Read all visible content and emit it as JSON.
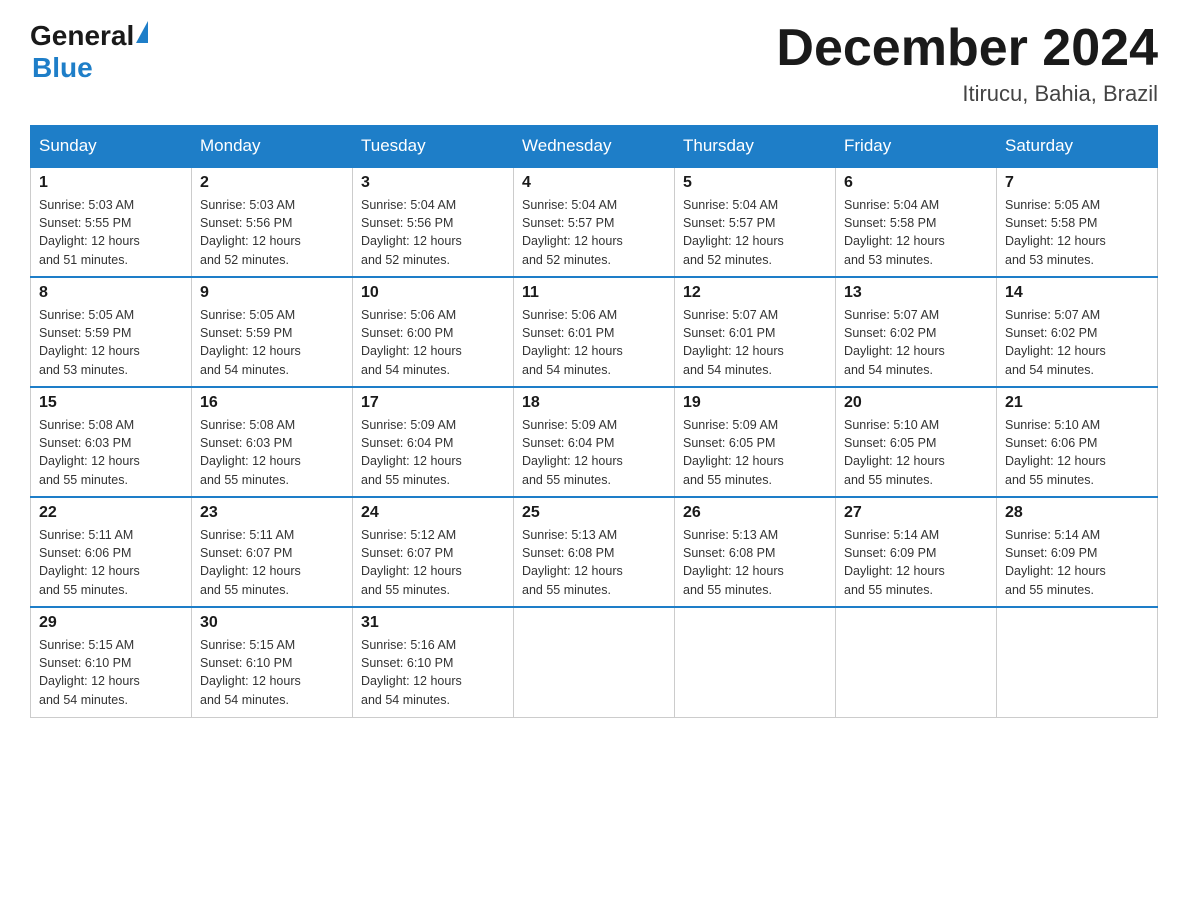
{
  "header": {
    "logo_general": "General",
    "logo_blue": "Blue",
    "title": "December 2024",
    "subtitle": "Itirucu, Bahia, Brazil"
  },
  "weekdays": [
    "Sunday",
    "Monday",
    "Tuesday",
    "Wednesday",
    "Thursday",
    "Friday",
    "Saturday"
  ],
  "weeks": [
    [
      {
        "day": "1",
        "sunrise": "5:03 AM",
        "sunset": "5:55 PM",
        "daylight": "12 hours and 51 minutes."
      },
      {
        "day": "2",
        "sunrise": "5:03 AM",
        "sunset": "5:56 PM",
        "daylight": "12 hours and 52 minutes."
      },
      {
        "day": "3",
        "sunrise": "5:04 AM",
        "sunset": "5:56 PM",
        "daylight": "12 hours and 52 minutes."
      },
      {
        "day": "4",
        "sunrise": "5:04 AM",
        "sunset": "5:57 PM",
        "daylight": "12 hours and 52 minutes."
      },
      {
        "day": "5",
        "sunrise": "5:04 AM",
        "sunset": "5:57 PM",
        "daylight": "12 hours and 52 minutes."
      },
      {
        "day": "6",
        "sunrise": "5:04 AM",
        "sunset": "5:58 PM",
        "daylight": "12 hours and 53 minutes."
      },
      {
        "day": "7",
        "sunrise": "5:05 AM",
        "sunset": "5:58 PM",
        "daylight": "12 hours and 53 minutes."
      }
    ],
    [
      {
        "day": "8",
        "sunrise": "5:05 AM",
        "sunset": "5:59 PM",
        "daylight": "12 hours and 53 minutes."
      },
      {
        "day": "9",
        "sunrise": "5:05 AM",
        "sunset": "5:59 PM",
        "daylight": "12 hours and 54 minutes."
      },
      {
        "day": "10",
        "sunrise": "5:06 AM",
        "sunset": "6:00 PM",
        "daylight": "12 hours and 54 minutes."
      },
      {
        "day": "11",
        "sunrise": "5:06 AM",
        "sunset": "6:01 PM",
        "daylight": "12 hours and 54 minutes."
      },
      {
        "day": "12",
        "sunrise": "5:07 AM",
        "sunset": "6:01 PM",
        "daylight": "12 hours and 54 minutes."
      },
      {
        "day": "13",
        "sunrise": "5:07 AM",
        "sunset": "6:02 PM",
        "daylight": "12 hours and 54 minutes."
      },
      {
        "day": "14",
        "sunrise": "5:07 AM",
        "sunset": "6:02 PM",
        "daylight": "12 hours and 54 minutes."
      }
    ],
    [
      {
        "day": "15",
        "sunrise": "5:08 AM",
        "sunset": "6:03 PM",
        "daylight": "12 hours and 55 minutes."
      },
      {
        "day": "16",
        "sunrise": "5:08 AM",
        "sunset": "6:03 PM",
        "daylight": "12 hours and 55 minutes."
      },
      {
        "day": "17",
        "sunrise": "5:09 AM",
        "sunset": "6:04 PM",
        "daylight": "12 hours and 55 minutes."
      },
      {
        "day": "18",
        "sunrise": "5:09 AM",
        "sunset": "6:04 PM",
        "daylight": "12 hours and 55 minutes."
      },
      {
        "day": "19",
        "sunrise": "5:09 AM",
        "sunset": "6:05 PM",
        "daylight": "12 hours and 55 minutes."
      },
      {
        "day": "20",
        "sunrise": "5:10 AM",
        "sunset": "6:05 PM",
        "daylight": "12 hours and 55 minutes."
      },
      {
        "day": "21",
        "sunrise": "5:10 AM",
        "sunset": "6:06 PM",
        "daylight": "12 hours and 55 minutes."
      }
    ],
    [
      {
        "day": "22",
        "sunrise": "5:11 AM",
        "sunset": "6:06 PM",
        "daylight": "12 hours and 55 minutes."
      },
      {
        "day": "23",
        "sunrise": "5:11 AM",
        "sunset": "6:07 PM",
        "daylight": "12 hours and 55 minutes."
      },
      {
        "day": "24",
        "sunrise": "5:12 AM",
        "sunset": "6:07 PM",
        "daylight": "12 hours and 55 minutes."
      },
      {
        "day": "25",
        "sunrise": "5:13 AM",
        "sunset": "6:08 PM",
        "daylight": "12 hours and 55 minutes."
      },
      {
        "day": "26",
        "sunrise": "5:13 AM",
        "sunset": "6:08 PM",
        "daylight": "12 hours and 55 minutes."
      },
      {
        "day": "27",
        "sunrise": "5:14 AM",
        "sunset": "6:09 PM",
        "daylight": "12 hours and 55 minutes."
      },
      {
        "day": "28",
        "sunrise": "5:14 AM",
        "sunset": "6:09 PM",
        "daylight": "12 hours and 55 minutes."
      }
    ],
    [
      {
        "day": "29",
        "sunrise": "5:15 AM",
        "sunset": "6:10 PM",
        "daylight": "12 hours and 54 minutes."
      },
      {
        "day": "30",
        "sunrise": "5:15 AM",
        "sunset": "6:10 PM",
        "daylight": "12 hours and 54 minutes."
      },
      {
        "day": "31",
        "sunrise": "5:16 AM",
        "sunset": "6:10 PM",
        "daylight": "12 hours and 54 minutes."
      },
      null,
      null,
      null,
      null
    ]
  ],
  "labels": {
    "sunrise": "Sunrise:",
    "sunset": "Sunset:",
    "daylight": "Daylight:"
  }
}
